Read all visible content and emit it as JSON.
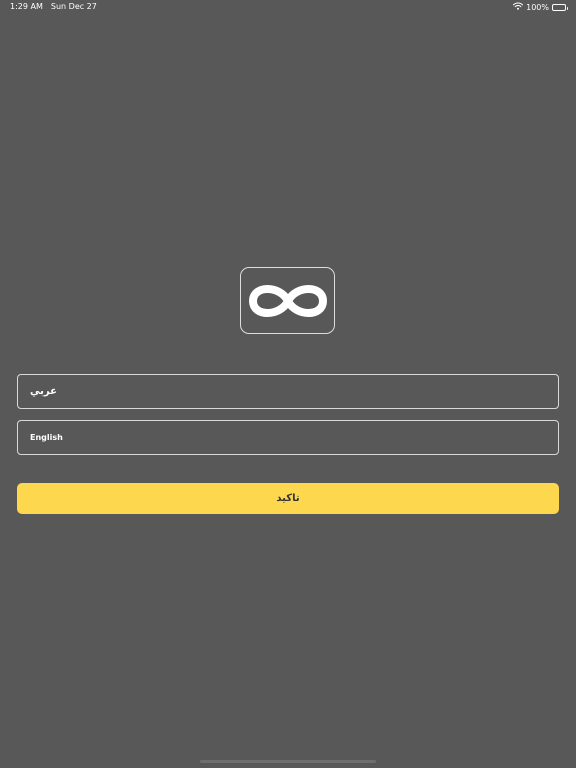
{
  "status_bar": {
    "time": "1:29 AM",
    "date": "Sun Dec 27",
    "battery": "100%",
    "wifi_icon": "wifi-icon",
    "battery_icon": "battery-icon",
    "battery_level": 1.0
  },
  "logo": {
    "icon": "infinity-icon"
  },
  "languages": {
    "arabic_label": "عربي",
    "english_label": "English"
  },
  "confirm": {
    "label": "تاكيد",
    "color": "#fdd84e"
  },
  "colors": {
    "background": "#585858",
    "accent": "#fdd84e"
  }
}
